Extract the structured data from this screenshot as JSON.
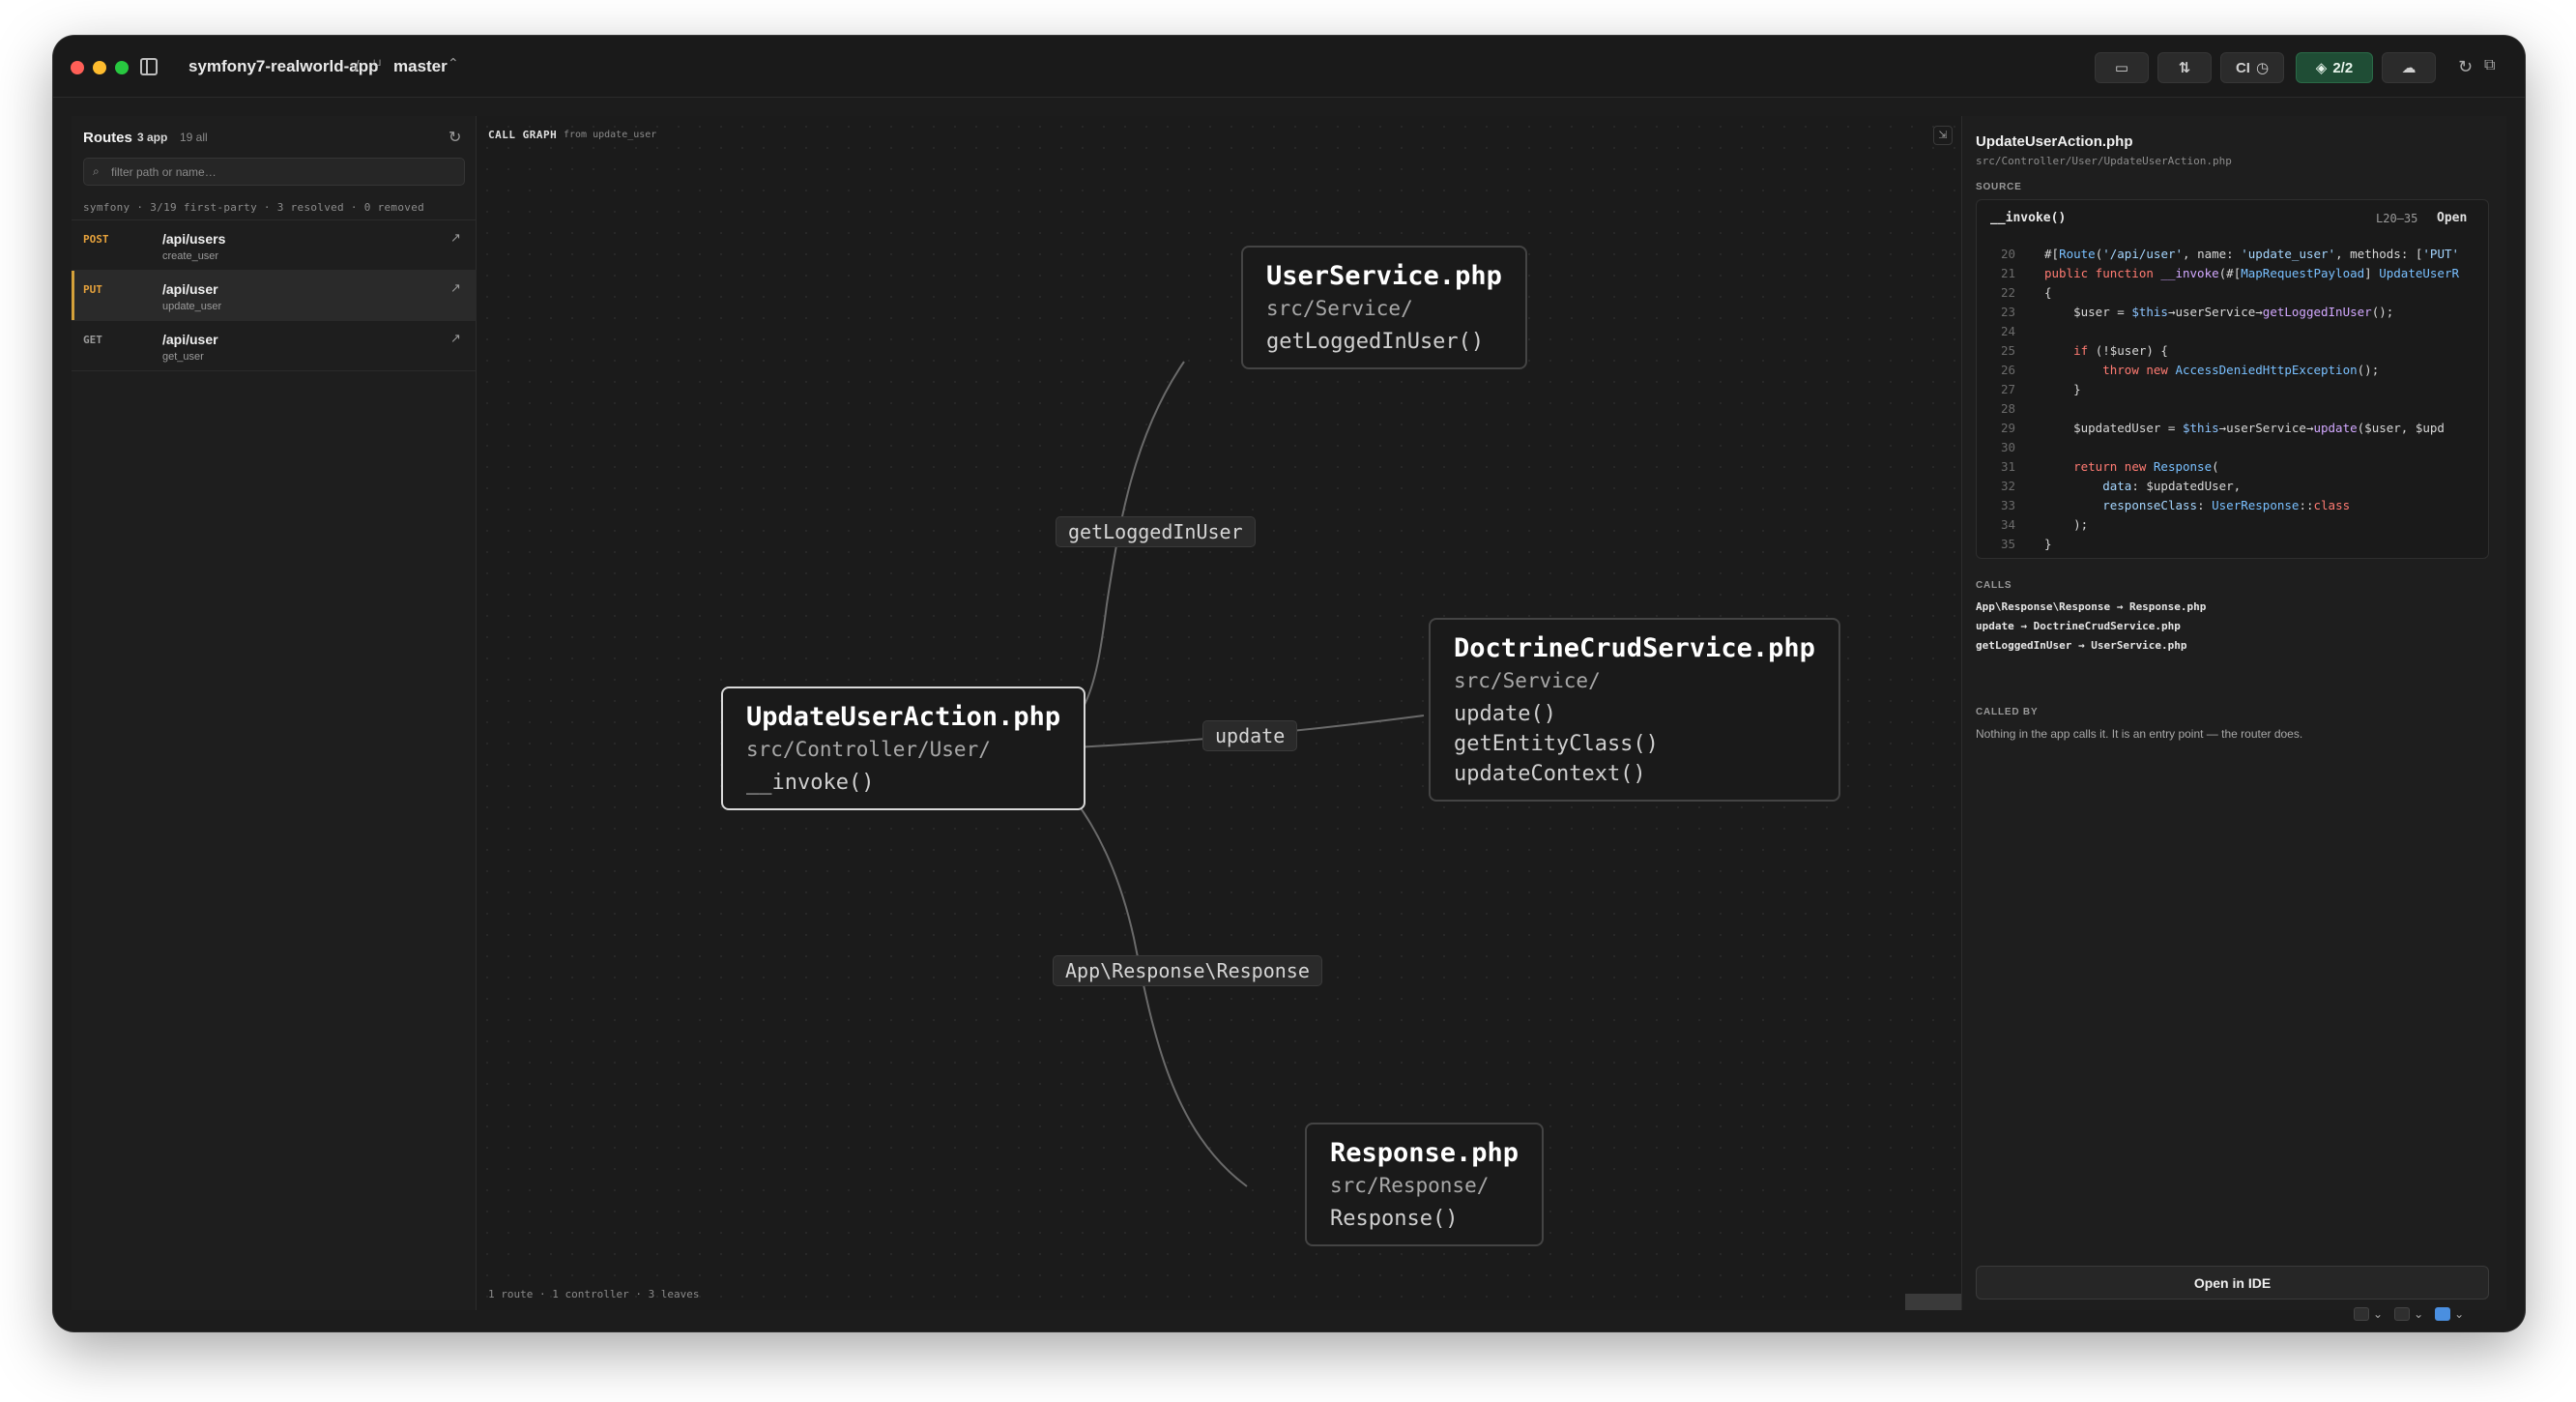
{
  "titlebar": {
    "project": "symfony7-realworld-app",
    "separator": "/",
    "branch": "master",
    "buttons": {
      "ci_label": "CI",
      "layers_label": "2/2"
    }
  },
  "sidebar": {
    "title": "Routes",
    "app_count": "3 app",
    "all_count": "19 all",
    "filter_placeholder": "filter path or name…",
    "summary": "symfony · 3/19 first-party · 3 resolved · 0 removed",
    "routes": [
      {
        "method": "POST",
        "method_color": "#e6a23c",
        "path": "/api/users",
        "name": "create_user",
        "selected": false
      },
      {
        "method": "PUT",
        "method_color": "#e6a23c",
        "path": "/api/user",
        "name": "update_user",
        "selected": true
      },
      {
        "method": "GET",
        "method_color": "#9a9a9a",
        "path": "/api/user",
        "name": "get_user",
        "selected": false
      }
    ]
  },
  "canvas": {
    "title": "CALL GRAPH",
    "title_from": "from update_user",
    "footer": "1 route · 1 controller · 3 leaves",
    "nodes": {
      "root": {
        "file": "UpdateUserAction.php",
        "dir": "src/Controller/User/",
        "methods": [
          "__invoke()"
        ]
      },
      "user_service": {
        "file": "UserService.php",
        "dir": "src/Service/",
        "methods": [
          "getLoggedInUser()"
        ]
      },
      "doctrine": {
        "file": "DoctrineCrudService.php",
        "dir": "src/Service/",
        "methods": [
          "update()",
          "getEntityClass()",
          "updateContext()"
        ]
      },
      "response": {
        "file": "Response.php",
        "dir": "src/Response/",
        "methods": [
          "Response()"
        ]
      }
    },
    "edges": {
      "to_user_service": "getLoggedInUser",
      "to_doctrine": "update",
      "to_response": "App\\Response\\Response"
    }
  },
  "panel": {
    "file": "UpdateUserAction.php",
    "path": "src/Controller/User/UpdateUserAction.php",
    "source_label": "SOURCE",
    "code": {
      "function": "__invoke()",
      "range": "L20–35",
      "open_label": "Open",
      "line_numbers": [
        "20",
        "21",
        "22",
        "23",
        "24",
        "25",
        "26",
        "27",
        "28",
        "29",
        "30",
        "31",
        "32",
        "33",
        "34",
        "35"
      ]
    },
    "calls_label": "CALLS",
    "calls": [
      "App\\Response\\Response → Response.php",
      "update → DoctrineCrudService.php",
      "getLoggedInUser → UserService.php"
    ],
    "called_by_label": "CALLED BY",
    "called_by_text": "Nothing in the app calls it. It is an entry point — the router does.",
    "open_ide_label": "Open in IDE"
  }
}
